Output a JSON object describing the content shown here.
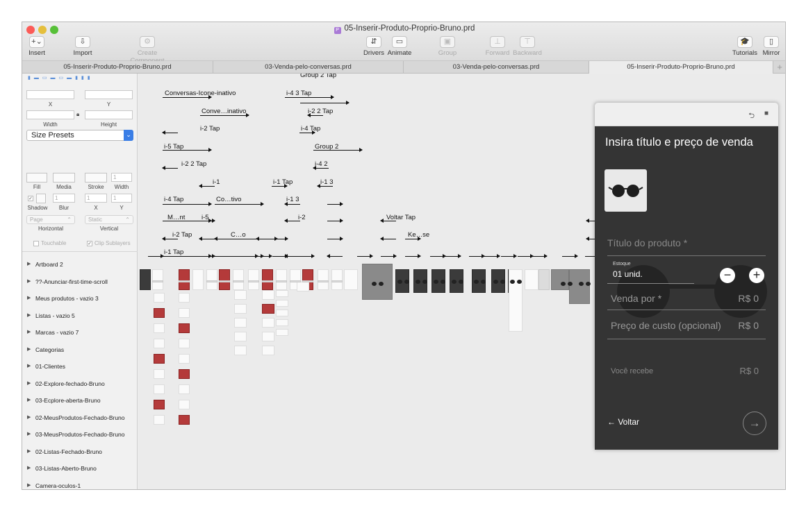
{
  "window": {
    "title": "05-Inserir-Produto-Proprio-Bruno.prd",
    "traffic_colors": [
      "#fc5b57",
      "#e5bf3c",
      "#57c038"
    ]
  },
  "toolbar": {
    "insert": {
      "label": "Insert",
      "icon": "+⌄"
    },
    "import": {
      "label": "Import",
      "icon": "⇩"
    },
    "create_component": {
      "label": "Create Component",
      "icon": "⚙"
    },
    "drivers": {
      "label": "Drivers",
      "icon": "⇵"
    },
    "animate": {
      "label": "Animate",
      "icon": "▭"
    },
    "group": {
      "label": "Group",
      "icon": "▣"
    },
    "forward": {
      "label": "Forward",
      "icon": "⊥"
    },
    "backward": {
      "label": "Backward",
      "icon": "⊤"
    },
    "tutorials": {
      "label": "Tutorials",
      "icon": "🎓"
    },
    "mirror": {
      "label": "Mirror",
      "icon": "▯"
    }
  },
  "tabs": [
    "05-Inserir-Produto-Proprio-Bruno.prd",
    "03-Venda-pelo-conversas.prd",
    "03-Venda-pelo-conversas.prd",
    "05-Inserir-Produto-Proprio-Bruno.prd"
  ],
  "tab_plus": "+",
  "inspector": {
    "x_label": "X",
    "y_label": "Y",
    "width_label": "Width",
    "height_label": "Height",
    "size_presets": "Size Presets",
    "fill": "Fill",
    "media": "Media",
    "stroke": "Stroke",
    "stroke_width_label": "Width",
    "stroke_width_value": "1",
    "shadow": "Shadow",
    "blur": "Blur",
    "blur_value": "1",
    "shadow_x_label": "X",
    "shadow_x_value": "1",
    "shadow_y_label": "Y",
    "shadow_y_value": "1",
    "horizontal_value": "Page",
    "horizontal_label": "Horizontal",
    "vertical_value": "Static",
    "vertical_label": "Vertical",
    "touchable": "Touchable",
    "clip_sublayers": "Clip Sublayers"
  },
  "layers": [
    "Artboard 2",
    "??-Anunciar-first-time-scroll",
    "Meus produtos - vazio 3",
    "Listas - vazio 5",
    "Marcas - vazio 7",
    "Categorias",
    "01-Clientes",
    "02-Explore-fechado-Bruno",
    "03-Ecplore-aberta-Bruno",
    "02-MeusProdutos-Fechado-Bruno",
    "03-MeusProdutos-Fechado-Bruno",
    "02-Listas-Fechado-Bruno",
    "03-Listas-Aberto-Bruno",
    "Camera-oculos-1"
  ],
  "flow_labels": {
    "group2tap": "Group 2 Tap",
    "conversas_icone": "Conversas-Icone-inativo",
    "i43tap": "i-4 3 Tap",
    "conve_inativo": "Conve…inativo",
    "i22tap": "i-2 2 Tap",
    "i2tap_a": "i-2 Tap",
    "i4tap": "i-4 Tap",
    "i5tap": "i-5 Tap",
    "group2": "Group 2",
    "i22tap_b": "i-2 2 Tap",
    "i42": "i-4 2",
    "i1": "i-1",
    "i1tap": "i-1 Tap",
    "i13": "i-1 3",
    "i4tap_b": "i-4 Tap",
    "cotivo": "Co…tivo",
    "i13_b": "i-1 3",
    "mnt": "M…nt",
    "i5": "i-5",
    "i2": "i-2",
    "voltar_tap": "Voltar Tap",
    "i2tap_b": "i-2 Tap",
    "co": "C…o",
    "kese": "Ke…se",
    "i1tap_b": "i-1 Tap"
  },
  "device": {
    "title": "Insira título e preço de venda",
    "product_title_placeholder": "Título do produto *",
    "stock_label": "Estoque",
    "stock_value": "01 unid.",
    "sell_price_label": "Venda por *",
    "sell_price_value": "R$ 0",
    "cost_price_label": "Preço de custo (opcional)",
    "cost_price_value": "R$ 0",
    "receive_label": "Você recebe",
    "receive_value": "R$ 0",
    "back_label": "Voltar",
    "back_icon": "arrow-left-icon",
    "next_icon": "arrow-right-icon",
    "minus": "−",
    "plus": "+",
    "undo_icon": "⮌",
    "camera_icon": "■"
  }
}
